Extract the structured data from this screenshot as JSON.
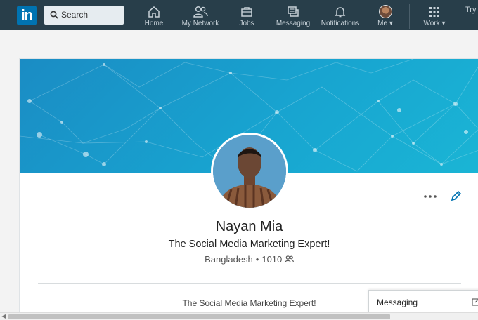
{
  "nav": {
    "logo_text": "in",
    "search_label": "Search",
    "items": [
      {
        "label": "Home",
        "icon": "home-icon"
      },
      {
        "label": "My Network",
        "icon": "network-icon"
      },
      {
        "label": "Jobs",
        "icon": "briefcase-icon"
      },
      {
        "label": "Messaging",
        "icon": "messaging-icon"
      },
      {
        "label": "Notifications",
        "icon": "bell-icon"
      },
      {
        "label": "Me",
        "icon": "avatar"
      },
      {
        "label": "Work",
        "icon": "grid-icon"
      }
    ],
    "try_text": "Try f"
  },
  "profile": {
    "name": "Nayan Mia",
    "headline": "The Social Media Marketing Expert!",
    "location": "Bangladesh",
    "connections": "1010",
    "summary": "The Social Media Marketing Expert!"
  },
  "messaging_tab": {
    "label": "Messaging"
  },
  "colors": {
    "nav_bg": "#283e4a",
    "brand": "#0073b1",
    "banner": "#1a9fd0"
  }
}
